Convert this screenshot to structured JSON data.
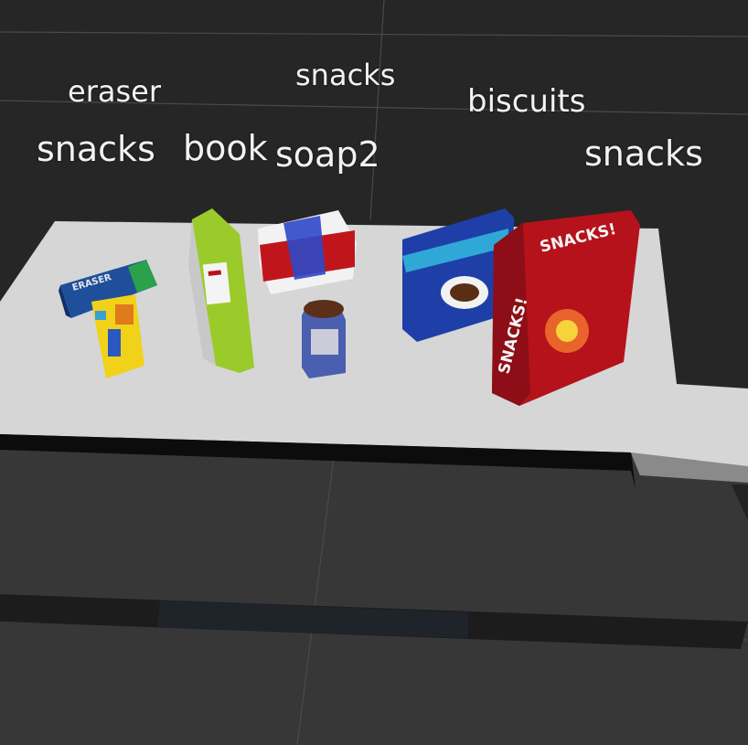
{
  "scene": {
    "description_labels": {
      "eraser": "eraser",
      "snacks_left": "snacks",
      "book": "book",
      "snacks_top": "snacks",
      "soap2": "soap2",
      "biscuits": "biscuits",
      "snacks_right": "snacks"
    },
    "box_text": {
      "eraser_box": "ERASER",
      "snacks_box_front": "SNACKS!",
      "snacks_box_side": "SNACKS!"
    }
  },
  "colors": {
    "background": "#2a2a2a",
    "table_top": "#d9d9d9",
    "table_edge": "#101010",
    "floor": "#3a3a3a",
    "label_text": "#f2f2f2",
    "snacks_red": "#b5121b",
    "biscuits_blue": "#1f3fa8",
    "eraser_blue": "#1f4f9a",
    "book_green": "#9bcb2a",
    "soap_red": "#c0161b",
    "yellow_item": "#f0d21a"
  }
}
